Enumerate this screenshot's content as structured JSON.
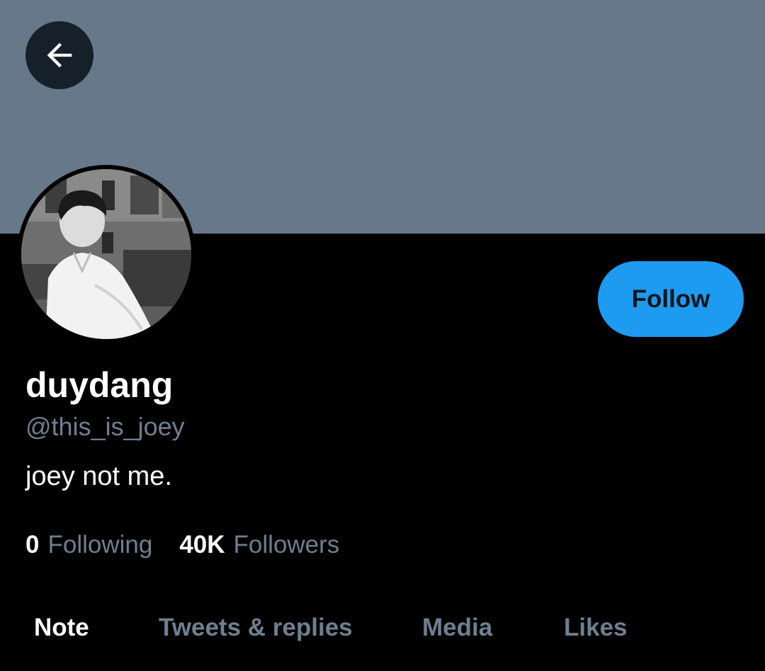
{
  "header": {
    "back_icon": "arrow-left-icon",
    "banner_color": "#66788a"
  },
  "profile": {
    "avatar_icon": "profile-photo",
    "display_name": "duydang",
    "handle": "@this_is_joey",
    "bio": "joey not me.",
    "follow_label": "Follow"
  },
  "stats": {
    "following_count": "0",
    "following_label": "Following",
    "followers_count": "40K",
    "followers_label": "Followers"
  },
  "tabs": [
    {
      "label": "Note",
      "active": true
    },
    {
      "label": "Tweets & replies",
      "active": false
    },
    {
      "label": "Media",
      "active": false
    },
    {
      "label": "Likes",
      "active": false
    }
  ],
  "colors": {
    "accent": "#1d9bf0",
    "background": "#000000",
    "muted_text": "#6e7f8f",
    "text": "#ffffff"
  }
}
